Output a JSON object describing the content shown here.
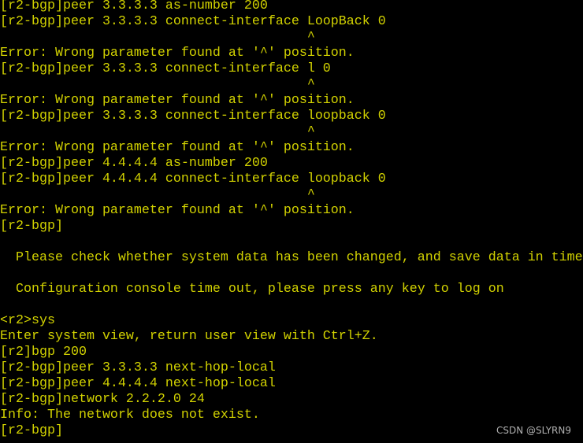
{
  "terminal": {
    "lines": [
      "[r2-bgp]peer 3.3.3.3 as-number 200",
      "[r2-bgp]peer 3.3.3.3 connect-interface LoopBack 0",
      "                                       ^",
      "Error: Wrong parameter found at '^' position.",
      "[r2-bgp]peer 3.3.3.3 connect-interface l 0",
      "                                       ^",
      "Error: Wrong parameter found at '^' position.",
      "[r2-bgp]peer 3.3.3.3 connect-interface loopback 0",
      "                                       ^",
      "Error: Wrong parameter found at '^' position.",
      "[r2-bgp]peer 4.4.4.4 as-number 200",
      "[r2-bgp]peer 4.4.4.4 connect-interface loopback 0",
      "                                       ^",
      "Error: Wrong parameter found at '^' position.",
      "[r2-bgp]",
      "",
      "  Please check whether system data has been changed, and save data in time",
      "",
      "  Configuration console time out, please press any key to log on",
      "",
      "<r2>sys",
      "Enter system view, return user view with Ctrl+Z.",
      "[r2]bgp 200",
      "[r2-bgp]peer 3.3.3.3 next-hop-local",
      "[r2-bgp]peer 4.4.4.4 next-hop-local",
      "[r2-bgp]network 2.2.2.0 24",
      "Info: The network does not exist.",
      "[r2-bgp]"
    ],
    "text_color": "#d2d200",
    "background": "#000000"
  },
  "watermark": "CSDN @SLYRN9"
}
